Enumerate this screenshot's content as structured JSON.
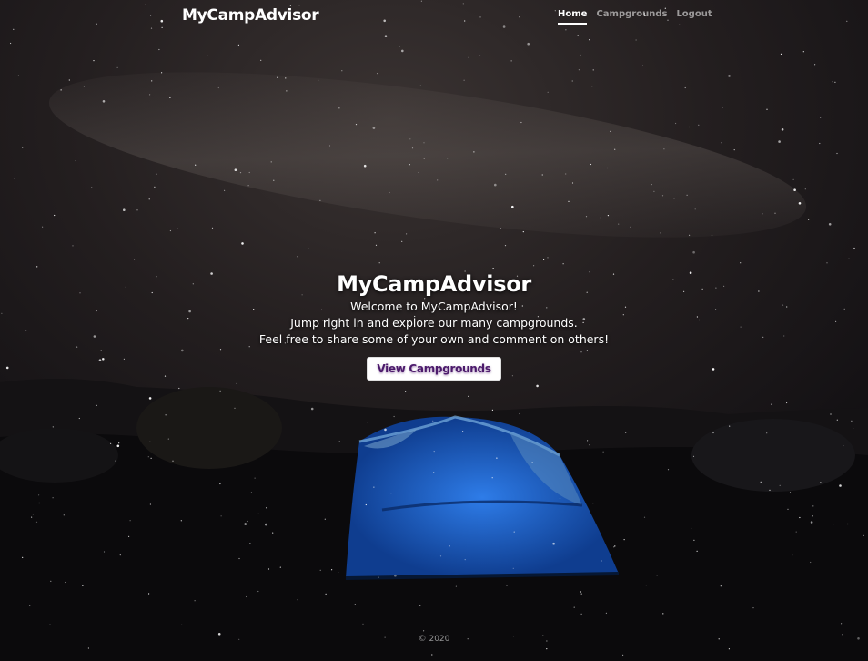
{
  "header": {
    "brand": "MyCampAdvisor",
    "nav": [
      {
        "label": "Home",
        "active": true
      },
      {
        "label": "Campgrounds",
        "active": false
      },
      {
        "label": "Logout",
        "active": false
      }
    ]
  },
  "hero": {
    "title": "MyCampAdvisor",
    "lines": [
      "Welcome to MyCampAdvisor!",
      "Jump right in and explore our many campgrounds.",
      "Feel free to share some of your own and comment on others!"
    ],
    "button_label": "View Campgrounds"
  },
  "footer": {
    "copyright": "© 2020"
  },
  "colors": {
    "sky": "#1a1718",
    "tent_blue": "#1f63c4",
    "button_text": "#4b1a6b"
  }
}
